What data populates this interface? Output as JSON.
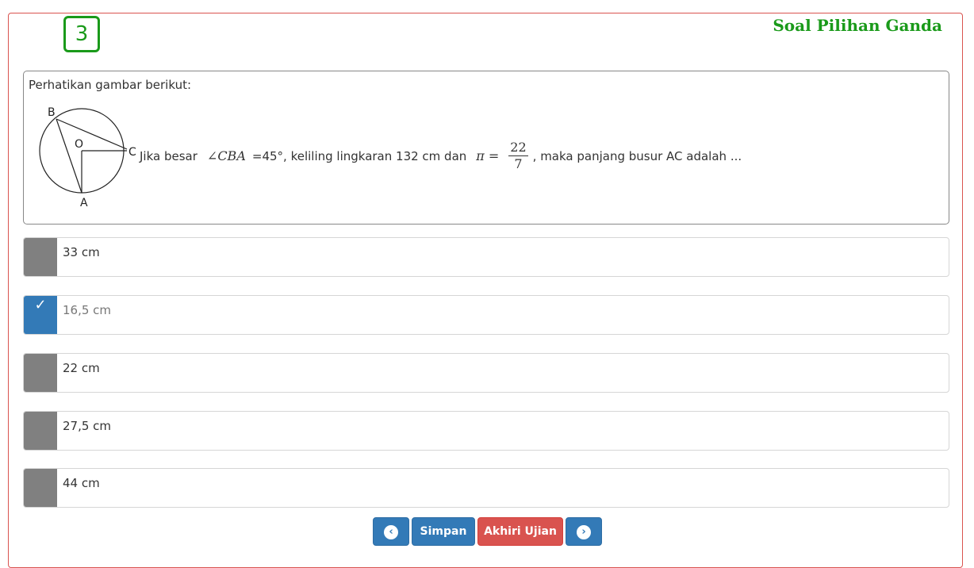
{
  "question": {
    "number": "3",
    "section_title": "Soal Pilihan Ganda",
    "intro": "Perhatikan gambar berikut:",
    "figure_labels": {
      "b": "B",
      "o": "O",
      "c": "C",
      "a": "A"
    },
    "text_part1": "Jika besar",
    "angle": "∠CBA",
    "text_part2": "=45°, keliling lingkaran 132 cm dan",
    "pi_symbol": "π =",
    "pi_numerator": "22",
    "pi_denominator": "7",
    "text_part3": ", maka panjang busur AC adalah ..."
  },
  "options": [
    {
      "label": "33 cm",
      "selected": false
    },
    {
      "label": "16,5 cm",
      "selected": true
    },
    {
      "label": "22 cm",
      "selected": false
    },
    {
      "label": "27,5 cm",
      "selected": false
    },
    {
      "label": "44 cm",
      "selected": false
    }
  ],
  "buttons": {
    "prev_icon": "chevron-left-icon",
    "save_label": "Simpan",
    "finish_label": "Akhiri Ujian",
    "next_icon": "chevron-right-icon"
  },
  "colors": {
    "accent_green": "#1a9a1a",
    "selected_blue": "#337ab7",
    "danger_red": "#d9534f",
    "unselected_gray": "#808080"
  }
}
